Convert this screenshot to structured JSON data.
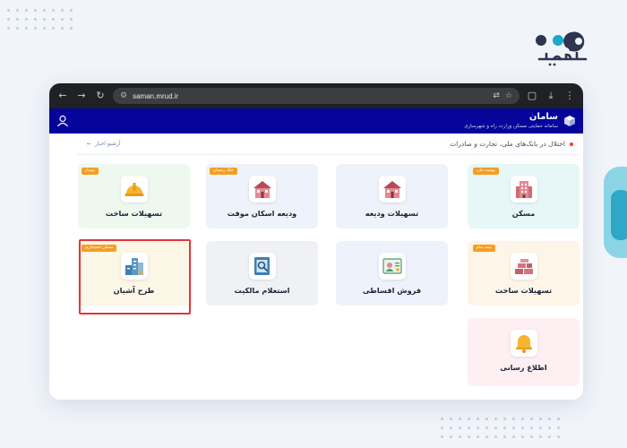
{
  "browser": {
    "url": "saman.mrud.ir",
    "buttons": {
      "back": "←",
      "forward": "→",
      "reload": "↻",
      "site_info": "⚙"
    }
  },
  "header": {
    "title": "سامان",
    "subtitle": "سامانه حمایتی مسکن وزارت راه و شهرسازی",
    "header_color": "#05049b"
  },
  "announcement": {
    "text": "اختلال در بانک‌های ملی، تجارت و صادرات",
    "archive_label": "آرشیو اخبار"
  },
  "cards": [
    {
      "label": "مسکن",
      "badge": "نهضت ملی",
      "icon": "building-icon",
      "bg": "#e7f6f6"
    },
    {
      "label": "تسهیلات ودیعه",
      "badge": "",
      "icon": "house-icon",
      "bg": "#eef2fa"
    },
    {
      "label": "ودیعه اسکان موقت",
      "badge": "جنگ رمضان",
      "icon": "house-icon",
      "bg": "#eef2fa"
    },
    {
      "label": "تسهیلات ساخت",
      "badge": "نوساز",
      "icon": "helmet-icon",
      "bg": "#eef8ef"
    },
    {
      "label": "تسهیلات ساخت",
      "badge": "نیمه تمام",
      "icon": "bricks-icon",
      "bg": "#fdf5e8"
    },
    {
      "label": "فروش اقساطی",
      "badge": "",
      "icon": "certificate-icon",
      "bg": "#eef2fa"
    },
    {
      "label": "استعلام مالکیت",
      "badge": "",
      "icon": "search-doc-icon",
      "bg": "#eff1f4"
    },
    {
      "label": "طرح آشیان",
      "badge": "مسکن استیجاری",
      "icon": "tower-icon",
      "bg": "#fbf6e6"
    },
    {
      "label": "اطلاع رسانی",
      "badge": "",
      "icon": "bell-icon",
      "bg": "#fdeff2"
    }
  ],
  "accent": {
    "badge": "#f59e22",
    "highlight": "#e0363d"
  }
}
